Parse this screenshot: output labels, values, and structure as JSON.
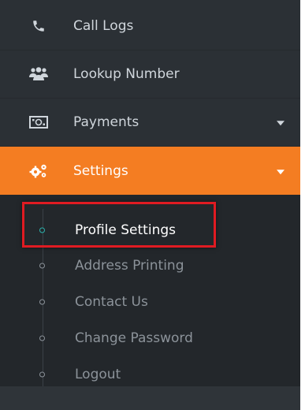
{
  "menu": {
    "items": [
      {
        "label": "Call Logs",
        "icon": "phone-icon"
      },
      {
        "label": "Lookup Number",
        "icon": "users-icon"
      },
      {
        "label": "Payments",
        "icon": "money-icon",
        "has_caret": true
      },
      {
        "label": "Settings",
        "icon": "gears-icon",
        "has_caret": true,
        "active": true
      }
    ]
  },
  "submenu": {
    "items": [
      {
        "label": "Profile Settings",
        "current": true
      },
      {
        "label": "Address Printing"
      },
      {
        "label": "Contact Us"
      },
      {
        "label": "Change Password"
      },
      {
        "label": "Logout"
      }
    ]
  },
  "colors": {
    "sidebar_bg": "#2b3035",
    "submenu_bg": "#23272b",
    "active_bg": "#f47d22",
    "highlight_border": "#e01b22",
    "current_dot": "#2cb3ad"
  }
}
